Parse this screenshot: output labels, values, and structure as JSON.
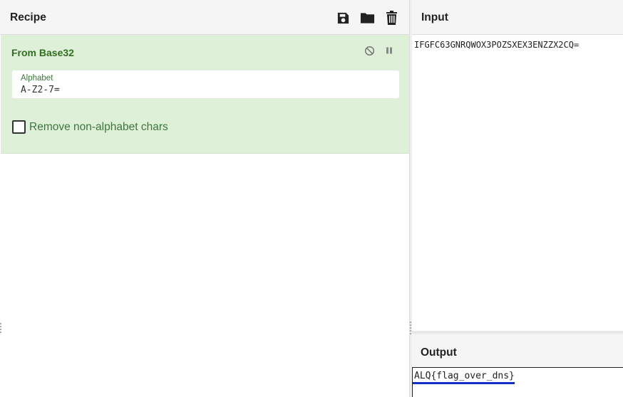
{
  "recipe": {
    "title": "Recipe",
    "icons": [
      "save-icon",
      "folder-icon",
      "trash-icon"
    ],
    "operation": {
      "name": "From Base32",
      "controls": [
        "disable-icon",
        "pause-icon"
      ],
      "alphabet_label": "Alphabet",
      "alphabet_value": "A-Z2-7=",
      "checkbox_label": "Remove non-alphabet chars",
      "checkbox_checked": false
    }
  },
  "input": {
    "title": "Input",
    "text": "IFGFC63GNRQWOX3POZSXEX3ENZZX2CQ="
  },
  "output": {
    "title": "Output",
    "text": "ALQ{flag_over_dns}"
  },
  "colors": {
    "operation_bg": "#dff0d8",
    "operation_text": "#3c763d",
    "header_bg": "#f5f5f5",
    "output_underline": "#1030c8"
  }
}
